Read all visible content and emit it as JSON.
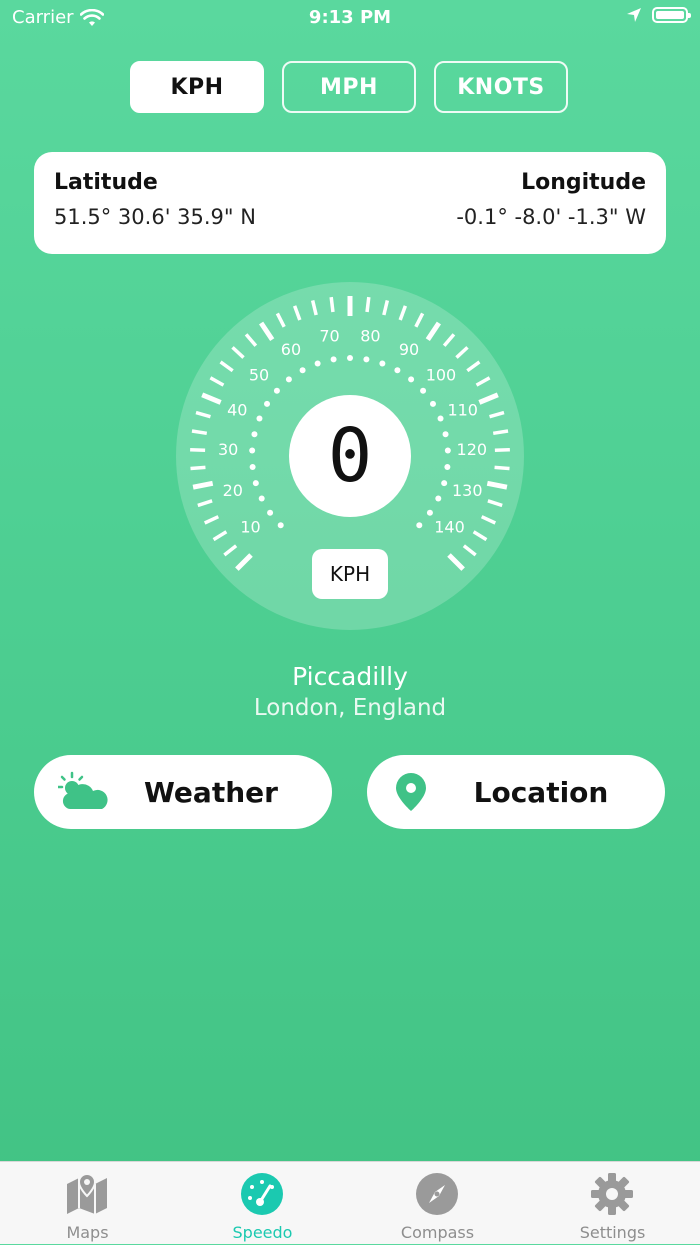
{
  "status": {
    "carrier": "Carrier",
    "time": "9:13 PM"
  },
  "units": {
    "kph": "KPH",
    "mph": "MPH",
    "knots": "KNOTS",
    "selected": "KPH"
  },
  "coords": {
    "latitude_label": "Latitude",
    "latitude_value": "51.5° 30.6' 35.9\" N",
    "longitude_label": "Longitude",
    "longitude_value": "-0.1° -8.0' -1.3\" W"
  },
  "gauge": {
    "speed": "0",
    "unit": "KPH",
    "ticks": [
      "10",
      "20",
      "30",
      "40",
      "50",
      "60",
      "70",
      "80",
      "90",
      "100",
      "110",
      "120",
      "130",
      "140"
    ]
  },
  "place": {
    "name": "Piccadilly",
    "region": "London, England"
  },
  "actions": {
    "weather": "Weather",
    "location": "Location"
  },
  "tabs": [
    {
      "label": "Maps"
    },
    {
      "label": "Speedo"
    },
    {
      "label": "Compass"
    },
    {
      "label": "Settings"
    }
  ],
  "colors": {
    "accent": "#1bc9b0",
    "background": "#4fd094",
    "icon_green": "#3fc287"
  }
}
